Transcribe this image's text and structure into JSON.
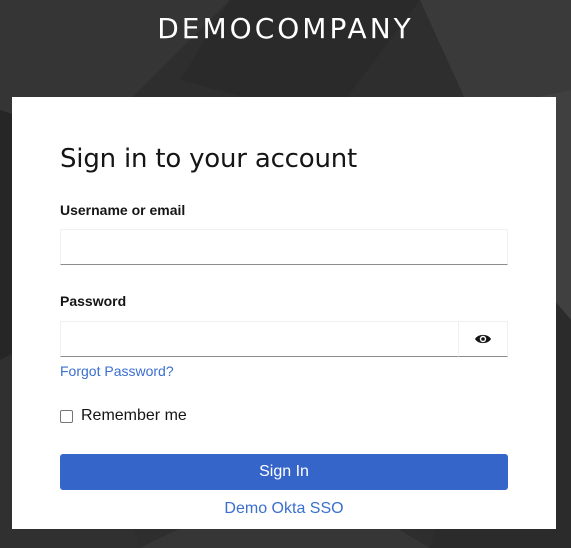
{
  "header": {
    "brand": "DEMOCOMPANY"
  },
  "login": {
    "title": "Sign in to your account",
    "username_label": "Username or email",
    "username_value": "",
    "password_label": "Password",
    "password_value": "",
    "show_password_icon": "eye-icon",
    "forgot_password": "Forgot Password?",
    "remember_me_label": "Remember me",
    "remember_me_checked": false,
    "sign_in_label": "Sign In",
    "sso_link": "Demo Okta SSO"
  },
  "colors": {
    "background": "#2d2d2d",
    "primary_button": "#3665c9",
    "link": "#3a6fcf",
    "card": "#ffffff"
  }
}
